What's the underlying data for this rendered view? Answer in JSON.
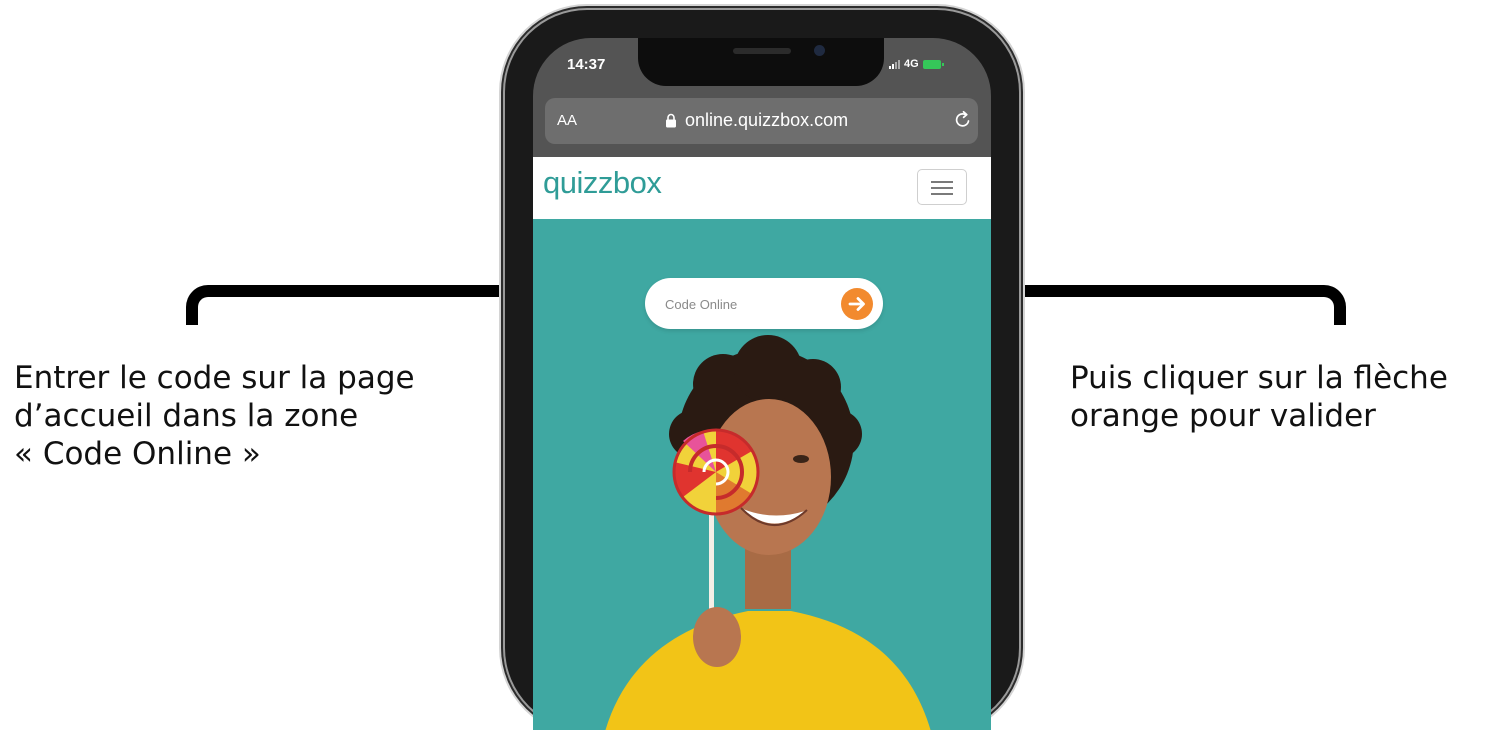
{
  "annotations": {
    "left_lines": [
      "Entrer le code sur la page",
      "d’accueil dans la zone",
      "« Code Online »"
    ],
    "right_lines": [
      "Puis cliquer sur la flèche",
      "orange pour valider"
    ]
  },
  "status_bar": {
    "time": "14:37",
    "network": "4G"
  },
  "browser": {
    "text_size_label": "AA",
    "url": "online.quizzbox.com"
  },
  "site": {
    "logo": "quizzbox",
    "code_input": {
      "placeholder": "Code Online",
      "value": ""
    }
  },
  "colors": {
    "brand_teal": "#2f9c97",
    "hero_background": "#3fa8a2",
    "accent_orange": "#f28a2e"
  },
  "icons": [
    "lock-icon",
    "reload-icon",
    "hamburger-menu-icon",
    "arrow-right-icon",
    "signal-icon",
    "battery-icon"
  ]
}
